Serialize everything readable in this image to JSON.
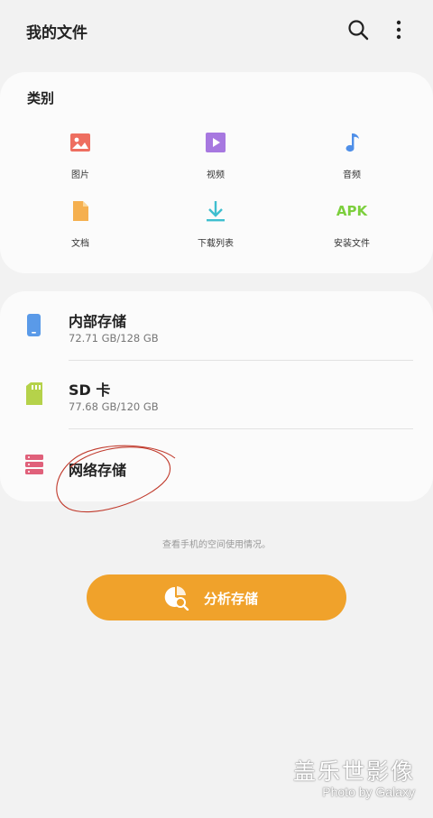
{
  "header": {
    "title": "我的文件",
    "search_icon": "search-icon",
    "more_icon": "more-vertical-icon"
  },
  "categories": {
    "title": "类别",
    "items": [
      {
        "label": "图片",
        "icon": "image-icon",
        "color": "#ee6e60"
      },
      {
        "label": "视频",
        "icon": "video-icon",
        "color": "#a778e0"
      },
      {
        "label": "音频",
        "icon": "music-note-icon",
        "color": "#4f8fe8"
      },
      {
        "label": "文档",
        "icon": "document-icon",
        "color": "#f5b04f"
      },
      {
        "label": "下载列表",
        "icon": "download-icon",
        "color": "#3fbfcf"
      },
      {
        "label": "安装文件",
        "icon": "apk-icon",
        "text": "APK",
        "color": "#7ccf3d"
      }
    ]
  },
  "storage": {
    "items": [
      {
        "name": "内部存储",
        "size": "72.71 GB/128 GB",
        "icon": "phone-icon",
        "color": "#5a9ae8"
      },
      {
        "name": "SD 卡",
        "size": "77.68 GB/120 GB",
        "icon": "sd-card-icon",
        "color": "#b5d24a"
      },
      {
        "name": "网络存储",
        "icon": "server-icon",
        "color": "#e0607a"
      }
    ]
  },
  "hint": "查看手机的空间使用情况。",
  "analyze_button": {
    "label": "分析存储",
    "icon": "analyze-storage-icon",
    "color": "#f0a22b"
  },
  "watermark": {
    "line1": "盖乐世影像",
    "line2": "Photo by Galaxy"
  }
}
